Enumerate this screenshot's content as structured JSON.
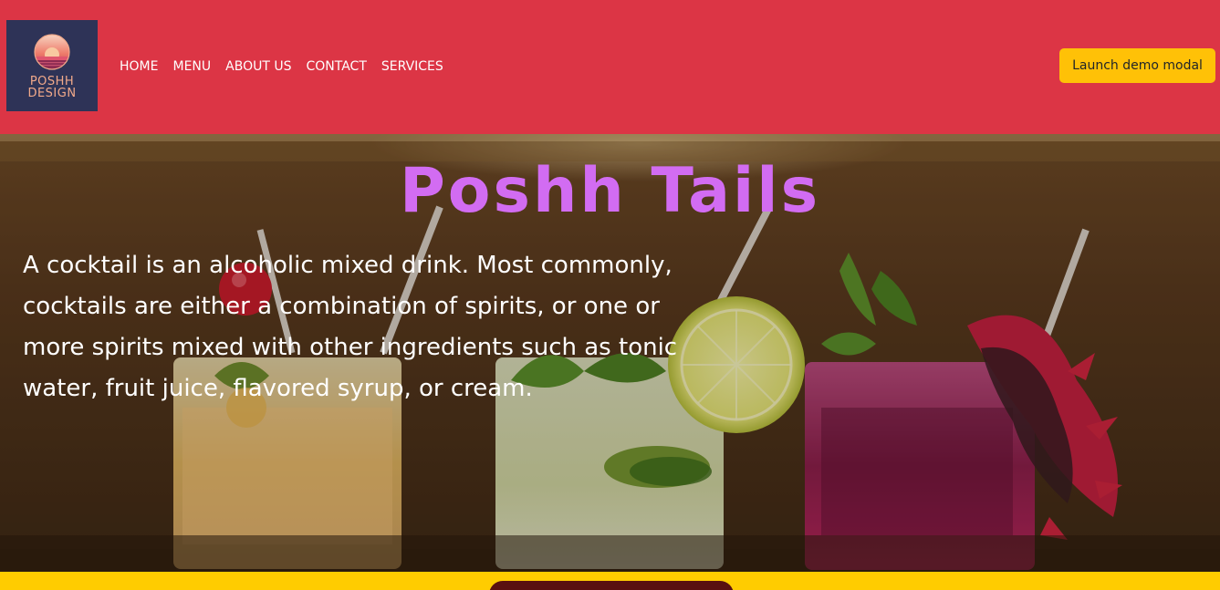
{
  "logo": {
    "line1": "POSHH",
    "line2": "DESIGN",
    "icon": "sunset-emblem-icon"
  },
  "nav": {
    "items": [
      {
        "label": "HOME"
      },
      {
        "label": "MENU"
      },
      {
        "label": "ABOUT US"
      },
      {
        "label": "CONTACT"
      },
      {
        "label": "SERVICES"
      }
    ],
    "cta_label": "Launch demo modal"
  },
  "hero": {
    "title": "Poshh Tails",
    "description": "A cocktail is an alcoholic mixed drink. Most commonly, cocktails are either a combination of spirits, or one or more spirits mixed with other ingredients such as tonic water, fruit juice, flavored syrup, or cream."
  },
  "colors": {
    "navbar": "#dc3545",
    "button": "#ffc107",
    "title": "#d26cf2",
    "logo_bg": "#2e3357",
    "bottom_band": "#ffcc00"
  }
}
